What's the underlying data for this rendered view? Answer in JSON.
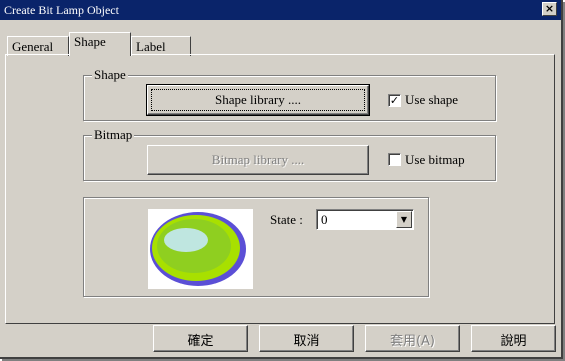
{
  "window": {
    "title": "Create Bit Lamp Object",
    "close_glyph": "×"
  },
  "tabs": [
    {
      "label": "General",
      "active": false
    },
    {
      "label": "Shape",
      "active": true
    },
    {
      "label": "Label",
      "active": false
    }
  ],
  "shape_group": {
    "legend": "Shape",
    "button_label": "Shape   library ....",
    "checkbox_label": "Use shape",
    "checkbox_checked": true,
    "check_glyph": "✓"
  },
  "bitmap_group": {
    "legend": "Bitmap",
    "button_label": "Bitmap   library ....",
    "checkbox_label": "Use bitmap",
    "checkbox_checked": false
  },
  "state": {
    "label": "State :",
    "value": "0",
    "arrow_glyph": "▼"
  },
  "bottom_buttons": {
    "ok": "確定",
    "cancel": "取消",
    "apply": "套用(A)",
    "help": "說明"
  },
  "colors": {
    "titlebar": "#0a246a",
    "dialog_face": "#d4d0c8",
    "lamp_outer": "#5b4fd6",
    "lamp_ring": "#a8e000",
    "lamp_inner": "#8fcf20",
    "lamp_highlight": "#bfe6e0"
  },
  "icons": [
    "close-icon",
    "checkmark-icon",
    "dropdown-arrow-icon",
    "lamp-preview-icon"
  ]
}
